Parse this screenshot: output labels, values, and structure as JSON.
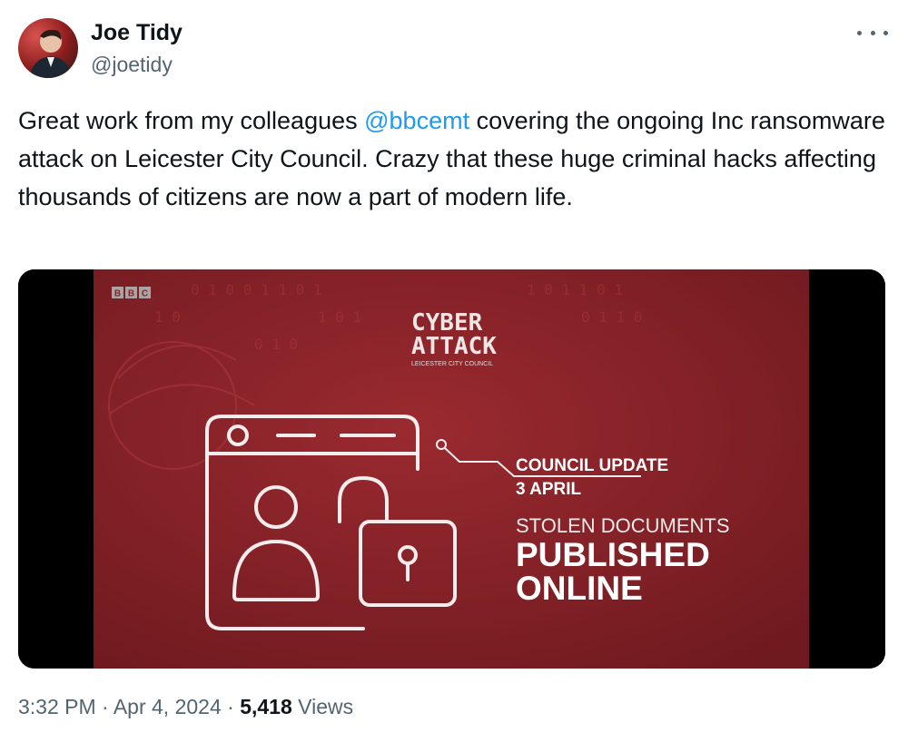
{
  "author": {
    "name": "Joe Tidy",
    "handle": "@joetidy"
  },
  "tweet": {
    "text_before": "Great work from my colleagues ",
    "mention": "@bbcemt",
    "text_after": " covering the ongoing Inc ransomware attack on Leicester City Council. Crazy that these huge criminal hacks affecting thousands of citizens are now a part of modern life."
  },
  "media": {
    "bbc_logo": "BBC",
    "title_line1": "CYBER",
    "title_line2": "ATTACK",
    "subtitle": "LEICESTER CITY COUNCIL",
    "update_label": "COUNCIL UPDATE",
    "update_date": "3 APRIL",
    "headline_line1": "STOLEN DOCUMENTS",
    "headline_line2": "PUBLISHED",
    "headline_line3": "ONLINE",
    "background_color": "#8a2328"
  },
  "footer": {
    "time": "3:32 PM",
    "separator1": " · ",
    "date": "Apr 4, 2024",
    "separator2": " · ",
    "views_count": "5,418",
    "views_label": " Views"
  },
  "colors": {
    "link": "#1d9bf0",
    "muted": "#536471",
    "text": "#0f1419"
  }
}
